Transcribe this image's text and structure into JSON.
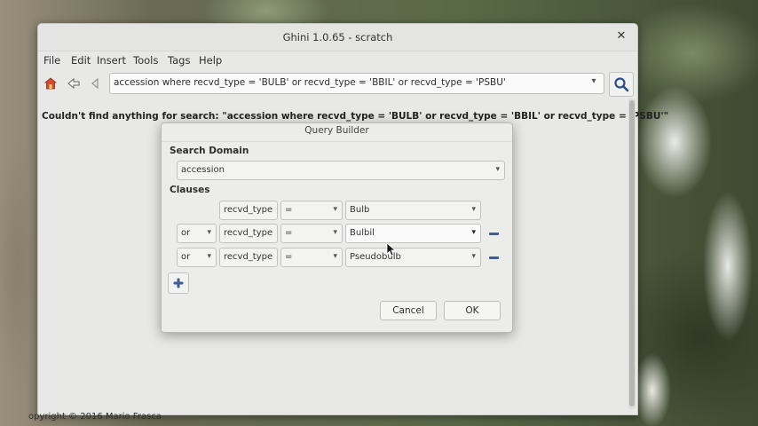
{
  "window": {
    "title": "Ghini 1.0.65 - scratch",
    "close_glyph": "✕"
  },
  "menu": {
    "items": [
      "File",
      "Edit",
      "Insert",
      "Tools",
      "Tags",
      "Help"
    ]
  },
  "toolbar": {
    "search_value": "accession where recvd_type = 'BULB' or recvd_type = 'BBIL' or recvd_type = 'PSBU'"
  },
  "status": {
    "message": "Couldn't find anything for search: \"accession where recvd_type = 'BULB' or recvd_type = 'BBIL' or recvd_type = 'PSBU'\""
  },
  "footer": {
    "copyright": "opyright © 2016 Mario Frasca"
  },
  "dialog": {
    "title": "Query Builder",
    "search_domain_label": "Search Domain",
    "search_domain_value": "accession",
    "clauses_label": "Clauses",
    "clauses": [
      {
        "connector": "",
        "field": "recvd_type",
        "operator": "=",
        "value": "Bulb"
      },
      {
        "connector": "or",
        "field": "recvd_type",
        "operator": "=",
        "value": "Bulbil"
      },
      {
        "connector": "or",
        "field": "recvd_type",
        "operator": "=",
        "value": "Pseudobulb"
      }
    ],
    "cancel_label": "Cancel",
    "ok_label": "OK"
  },
  "colors": {
    "accent_blue": "#3d5d96",
    "window_bg": "#e8e8e7"
  },
  "icons": [
    "home-icon",
    "back-icon",
    "history-icon",
    "search-icon",
    "add-icon",
    "remove-icon",
    "dropdown-icon",
    "close-icon",
    "mouse-cursor-icon"
  ]
}
